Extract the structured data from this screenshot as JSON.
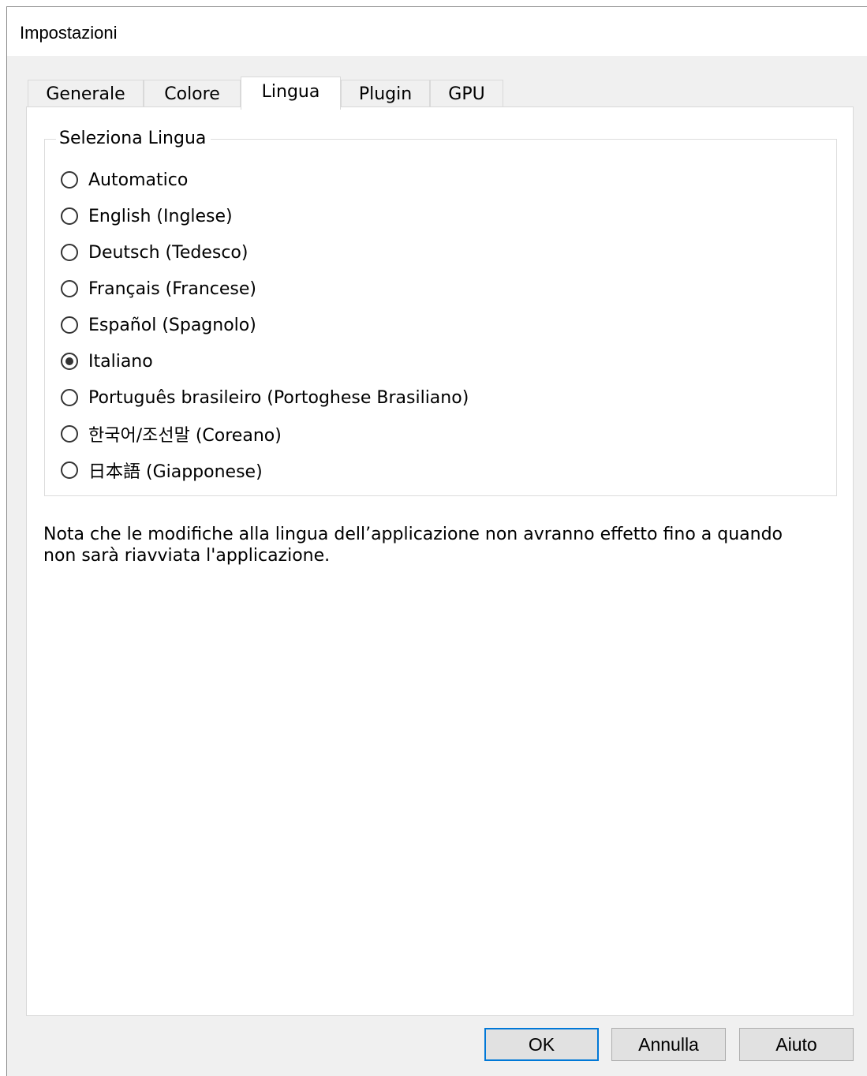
{
  "window": {
    "title": "Impostazioni"
  },
  "tabs": [
    {
      "label": "Generale",
      "active": false
    },
    {
      "label": "Colore",
      "active": false
    },
    {
      "label": "Lingua",
      "active": true
    },
    {
      "label": "Plugin",
      "active": false
    },
    {
      "label": "GPU",
      "active": false
    }
  ],
  "language_group": {
    "legend": "Seleziona Lingua",
    "options": [
      {
        "label": "Automatico",
        "checked": false
      },
      {
        "label": "English (Inglese)",
        "checked": false
      },
      {
        "label": "Deutsch (Tedesco)",
        "checked": false
      },
      {
        "label": "Français (Francese)",
        "checked": false
      },
      {
        "label": "Español (Spagnolo)",
        "checked": false
      },
      {
        "label": "Italiano",
        "checked": true
      },
      {
        "label": "Português brasileiro (Portoghese Brasiliano)",
        "checked": false
      },
      {
        "label": "한국어/조선말 (Coreano)",
        "checked": false
      },
      {
        "label": "日本語 (Giapponese)",
        "checked": false
      }
    ]
  },
  "note": {
    "line1": "Nota che le modifiche alla lingua dell’applicazione non avranno effetto fino a quando",
    "line2": "non sarà riavviata l'applicazione."
  },
  "buttons": {
    "ok_label": "OK",
    "cancel_label": "Annulla",
    "help_label": "Aiuto"
  },
  "colors": {
    "dialog_bg": "#f0f0f0",
    "panel_bg": "#ffffff",
    "default_button_border": "#0078d7"
  }
}
